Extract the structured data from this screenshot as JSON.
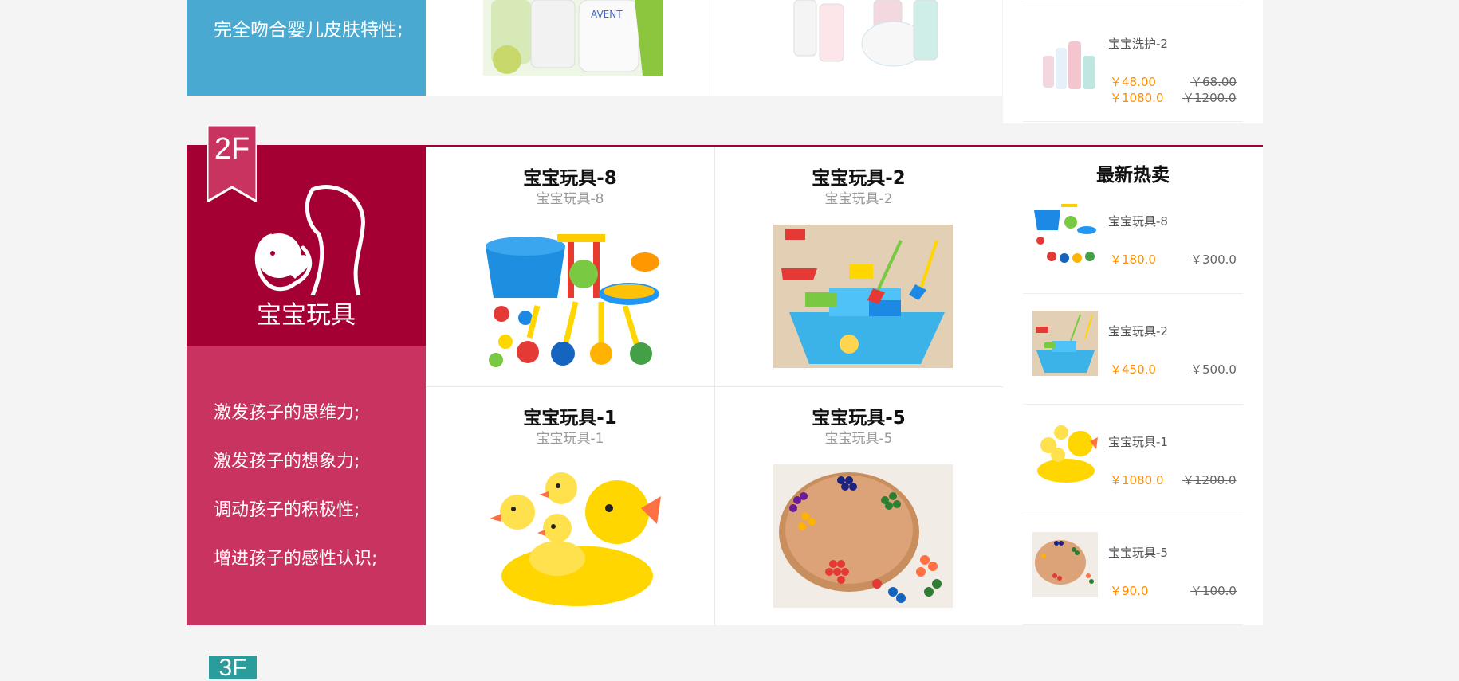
{
  "floor1": {
    "description": "完全吻合婴儿皮肤特性;",
    "hot_item": {
      "name": "宝宝洗护-2",
      "price": "￥48.00",
      "old_price": "￥68.00",
      "price2": "￥1080.0",
      "old_price2": "￥1200.0"
    }
  },
  "floor2": {
    "badge": "2F",
    "title": "宝宝玩具",
    "features": [
      "激发孩子的思维力;",
      "激发孩子的想象力;",
      "调动孩子的积极性;",
      "增进孩子的感性认识;"
    ],
    "products": [
      {
        "title": "宝宝玩具-8",
        "subtitle": "宝宝玩具-8"
      },
      {
        "title": "宝宝玩具-2",
        "subtitle": "宝宝玩具-2"
      },
      {
        "title": "宝宝玩具-1",
        "subtitle": "宝宝玩具-1"
      },
      {
        "title": "宝宝玩具-5",
        "subtitle": "宝宝玩具-5"
      }
    ],
    "hot_title": "最新热卖",
    "hot_items": [
      {
        "name": "宝宝玩具-8",
        "price": "￥180.0",
        "old_price": "￥300.0"
      },
      {
        "name": "宝宝玩具-2",
        "price": "￥450.0",
        "old_price": "￥500.0"
      },
      {
        "name": "宝宝玩具-1",
        "price": "￥1080.0",
        "old_price": "￥1200.0"
      },
      {
        "name": "宝宝玩具-5",
        "price": "￥90.0",
        "old_price": "￥100.0"
      }
    ]
  },
  "floor3": {
    "badge": "3F"
  },
  "colors": {
    "floor1_accent": "#4aa9d0",
    "floor2_accent": "#a50034",
    "floor2_light": "#c8345f",
    "floor3_accent": "#2b9c9c",
    "price": "#ff8c00"
  }
}
